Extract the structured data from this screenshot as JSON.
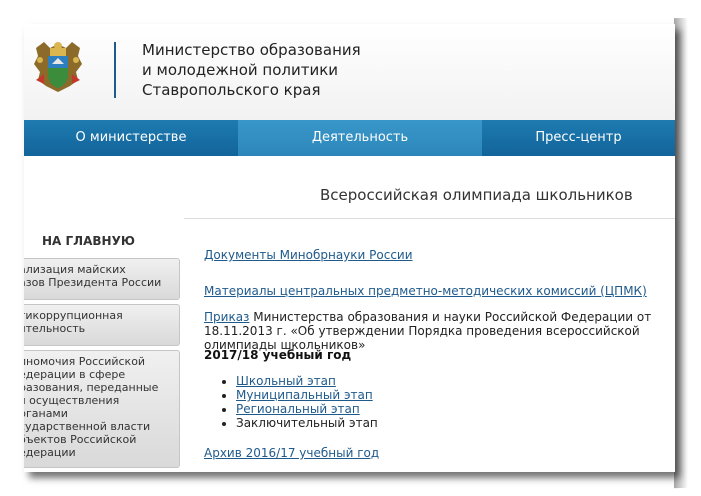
{
  "header": {
    "ministry_title": [
      "Министерство образования",
      "и молодежной политики",
      "Ставропольского края"
    ]
  },
  "nav": {
    "items": [
      {
        "label": "О министерстве"
      },
      {
        "label": "Деятельность",
        "active": true
      },
      {
        "label": "Пресс-центр"
      }
    ]
  },
  "page_title": "Всероссийская олимпиада школьников",
  "sidebar": {
    "home": "НА ГЛАВНУЮ",
    "buttons": [
      {
        "lines": [
          "ализация майских",
          "азов Президента России"
        ]
      },
      {
        "lines": [
          "тикоррупционная",
          "ятельность"
        ]
      },
      {
        "lines": [
          "лномочия Российской",
          "едерации в сфере",
          "разования, переданные",
          "я осуществления",
          "рганами",
          "сударственной власти",
          "бъектов Российской",
          "едерации"
        ]
      }
    ]
  },
  "content": {
    "docs_link": "Документы Минобрнауки России",
    "materials_link": "Материалы центральных предметно-методических комиссий (ЦПМК)",
    "order_link": "Приказ",
    "order_text": " Министерства образования и науки Российской Федерации от 18.11.2013 г. «Об утверждении Порядка проведения всероссийской олимпиады школьников»",
    "year_heading": "2017/18 учебный год",
    "stages": [
      {
        "label": "Школьный этап",
        "link": true
      },
      {
        "label": "Муниципальный этап",
        "link": true
      },
      {
        "label": "Региональный этап",
        "link": true
      },
      {
        "label": "Заключительный этап",
        "link": false
      }
    ],
    "archive_link": "Архив 2016/17 учебный год"
  },
  "colors": {
    "nav_bg": "#12649a",
    "nav_active": "#2c86ba",
    "link": "#1f5a8c"
  }
}
